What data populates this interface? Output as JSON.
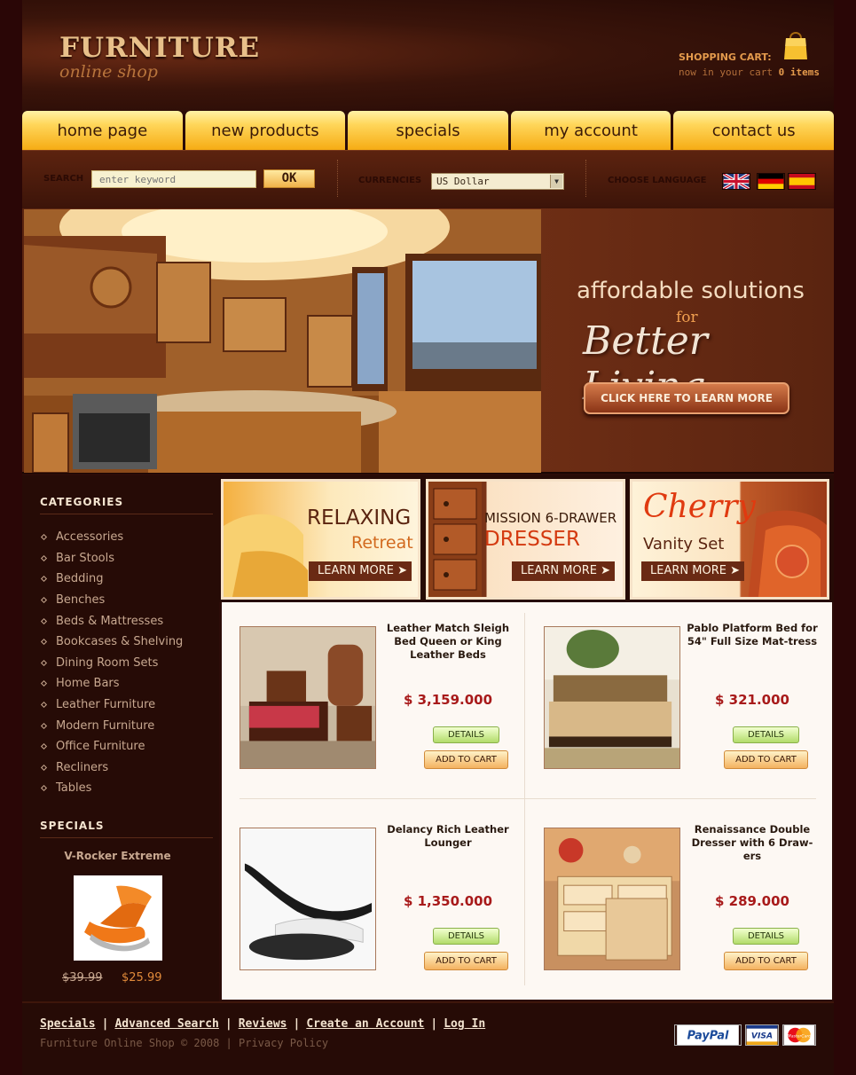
{
  "header": {
    "logo_title": "FURNITURE",
    "logo_subtitle": "online shop",
    "cart_title": "SHOPPING CART:",
    "cart_prefix": "now in your cart ",
    "cart_count": "0 items"
  },
  "nav": {
    "items": [
      {
        "label": "home page"
      },
      {
        "label": "new products"
      },
      {
        "label": "specials"
      },
      {
        "label": "my account"
      },
      {
        "label": "contact us"
      }
    ]
  },
  "search": {
    "label": "SEARCH",
    "placeholder": "enter keyword",
    "button": "OK",
    "currencies_label": "CURRENCIES",
    "currency_selected": "US Dollar",
    "language_label": "CHOOSE LANGUAGE",
    "languages": [
      "english-flag-icon",
      "german-flag-icon",
      "spanish-flag-icon"
    ]
  },
  "hero": {
    "line1": "affordable solutions",
    "line2": "for",
    "line3": "Better Living",
    "button": "CLICK HERE TO LEARN MORE"
  },
  "sidebar": {
    "categories_title": "CATEGORIES",
    "categories": [
      "Accessories",
      "Bar Stools",
      "Bedding",
      "Benches",
      "Beds & Mattresses",
      "Bookcases & Shelving",
      "Dining Room Sets",
      "Home Bars",
      "Leather Furniture",
      "Modern Furniture",
      "Office Furniture",
      "Recliners",
      "Tables"
    ],
    "specials_title": "SPECIALS",
    "special": {
      "name": "V-Rocker Extreme",
      "old_price": "$39.99",
      "new_price": "$25.99"
    }
  },
  "banners": [
    {
      "line1": "RELAXING",
      "line2": "Retreat",
      "button": "LEARN MORE"
    },
    {
      "line1": "MISSION 6-DRAWER",
      "line2": "DRESSER",
      "button": "LEARN MORE"
    },
    {
      "line1": "Cherry",
      "line2": "Vanity Set",
      "button": "LEARN MORE"
    }
  ],
  "products": [
    {
      "name": "Leather Match Sleigh Bed Queen or King Leather Beds",
      "price": "$ 3,159.000",
      "details": "DETAILS",
      "cart": "ADD TO CART"
    },
    {
      "name": "Pablo Platform Bed for 54\" Full Size Mat-tress",
      "price": "$ 321.000",
      "details": "DETAILS",
      "cart": "ADD TO CART"
    },
    {
      "name": "Delancy Rich Leather Lounger",
      "price": "$ 1,350.000",
      "details": "DETAILS",
      "cart": "ADD TO CART"
    },
    {
      "name": "Renaissance Double Dresser with 6 Draw-ers",
      "price": "$ 289.000",
      "details": "DETAILS",
      "cart": "ADD TO CART"
    }
  ],
  "footer": {
    "links": [
      "Specials",
      "Advanced Search",
      "Reviews",
      "Create an Account",
      "Log In"
    ],
    "separator": "|",
    "copyright": "Furniture Online Shop © 2008",
    "privacy": "Privacy Policy",
    "payments": [
      "PayPal",
      "VISA",
      "MasterCard"
    ]
  },
  "colors": {
    "background": "#2b0c08",
    "nav_gold": "#ffd65a",
    "accent_orange": "#e08a3a",
    "price_red": "#a81a1a"
  }
}
